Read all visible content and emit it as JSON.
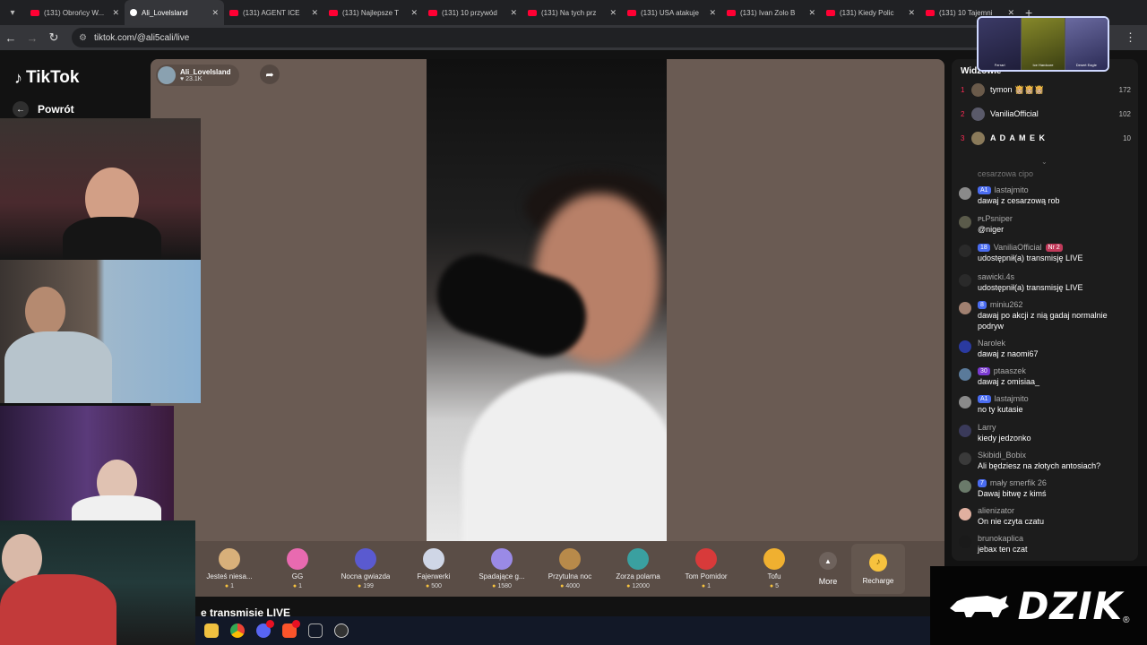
{
  "browser": {
    "tabs": [
      {
        "title": "(131) Obrońcy W...",
        "active": false
      },
      {
        "title": "Ali_Lovelsland",
        "active": true
      },
      {
        "title": "(131) AGENT ICE",
        "active": false
      },
      {
        "title": "(131) Najlepsze T",
        "active": false
      },
      {
        "title": "(131) 10 przywód",
        "active": false
      },
      {
        "title": "(131) Na tych prz",
        "active": false
      },
      {
        "title": "(131) USA atakuje",
        "active": false
      },
      {
        "title": "(131) Ivan Zolo B",
        "active": false
      },
      {
        "title": "(131) Kiedy Polic",
        "active": false
      },
      {
        "title": "(131) 10 Tajemni",
        "active": false
      }
    ],
    "url": "tiktok.com/@ali5cali/live"
  },
  "sidebar": {
    "logo": "TikTok",
    "back_label": "Powrót"
  },
  "host": {
    "name": "Ali_Lovelsland",
    "viewers": "23.1K"
  },
  "gifts": [
    {
      "name": "Jesteś niesa...",
      "price": "1",
      "icon": "hamster-icon",
      "color": "#d8b07a"
    },
    {
      "name": "GG",
      "price": "1",
      "icon": "gg-icon",
      "color": "#e86ab0"
    },
    {
      "name": "Nocna gwiazda",
      "price": "199",
      "icon": "ghost-icon",
      "color": "#5a5ad0"
    },
    {
      "name": "Fajerwerki",
      "price": "500",
      "icon": "firework-icon",
      "color": "#cfd6e6"
    },
    {
      "name": "Spadające g...",
      "price": "1580",
      "icon": "star-icon",
      "color": "#9a8ae6"
    },
    {
      "name": "Przytulna noc",
      "price": "4000",
      "icon": "house-icon",
      "color": "#b88a4a"
    },
    {
      "name": "Zorza polarna",
      "price": "12000",
      "icon": "igloo-icon",
      "color": "#3aa0a0"
    },
    {
      "name": "Tom Pomidor",
      "price": "1",
      "icon": "tomato-icon",
      "color": "#d83a3a"
    },
    {
      "name": "Tofu",
      "price": "5",
      "icon": "tofu-icon",
      "color": "#f0b030"
    }
  ],
  "more_label": "More",
  "recharge_label": "Recharge",
  "bottom_text": "e transmisje LIVE",
  "viewers_panel": {
    "heading": "Widzowie",
    "ranking": [
      {
        "rank": "1",
        "user": "tymon 👸🏼👸🏼👸🏼",
        "points": "172"
      },
      {
        "rank": "2",
        "user": "VaniliaOfficial",
        "points": "102"
      },
      {
        "rank": "3",
        "user": "A D A M E K",
        "points": "10"
      }
    ],
    "cut_message": "cesarzowa cipo"
  },
  "chat": [
    {
      "user": "lastajmito",
      "badge": "A1",
      "badge_color": "#4a6cf0",
      "text": "dawaj z cesarzową rob",
      "avatar_color": "#8a8a8a"
    },
    {
      "user": "ᴘʟPsniper",
      "badge": "",
      "badge_color": "",
      "text": "@niger",
      "avatar_color": "#5a5a4a"
    },
    {
      "user": "VaniliaOfficial",
      "badge": "18",
      "badge_color": "#4a6cf0",
      "text": "udostępnił(a) transmisję LIVE",
      "avatar_color": "#2a2a2a",
      "extra_badge": "Nr 2"
    },
    {
      "user": "sawicki.4s",
      "badge": "",
      "badge_color": "",
      "text": "udostępnił(a) transmisję LIVE",
      "avatar_color": "#2a2a2a"
    },
    {
      "user": "miniu262",
      "badge": "8",
      "badge_color": "#4a6cf0",
      "text": "dawaj po akcji z nią gadaj normalnie podryw",
      "avatar_color": "#a08070"
    },
    {
      "user": "Narolek",
      "badge": "",
      "badge_color": "",
      "text": "dawaj z naomi67",
      "avatar_color": "#2a3aa0"
    },
    {
      "user": "ptaaszek",
      "badge": "30",
      "badge_color": "#7a3ad0",
      "text": "dawaj z omisiaa_",
      "avatar_color": "#5a7a9a"
    },
    {
      "user": "lastajmito",
      "badge": "A1",
      "badge_color": "#4a6cf0",
      "text": "no ty kutasie",
      "avatar_color": "#8a8a8a"
    },
    {
      "user": "Larry",
      "badge": "",
      "badge_color": "",
      "text": "kiedy jedzonko",
      "avatar_color": "#3a3a5a"
    },
    {
      "user": "Skibidi_Bobix",
      "badge": "",
      "badge_color": "",
      "text": "Ali będziesz na złotych antosiach?",
      "avatar_color": "#3a3a3a"
    },
    {
      "user": "mały smerfik 26",
      "badge": "7",
      "badge_color": "#4a6cf0",
      "text": "Dawaj bitwę z kimś",
      "avatar_color": "#6a7a6a"
    },
    {
      "user": "alienizator",
      "badge": "",
      "badge_color": "",
      "text": "On nie czyta czatu",
      "avatar_color": "#e0b0a0"
    },
    {
      "user": "brunokaplica",
      "badge": "",
      "badge_color": "",
      "text": "jebax ten czat",
      "avatar_color": "#1a1a1a"
    }
  ],
  "overlay": {
    "cards": [
      "Ferrari",
      "Ice Hardcore",
      "Desert Eagle"
    ]
  },
  "taskbar_apps": [
    "folder-icon",
    "chrome-icon",
    "discord-icon",
    "brave-icon",
    "xbox-icon",
    "obs-icon"
  ],
  "brand": {
    "word": "DZIK",
    "reg": "®"
  }
}
